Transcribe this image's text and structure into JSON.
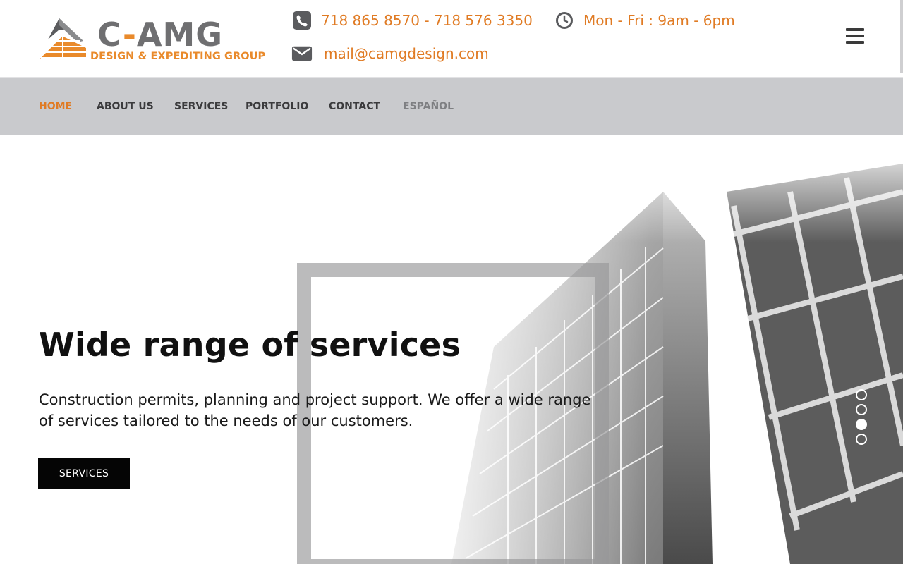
{
  "brand": {
    "logo_main_left": "C",
    "logo_main_dash": "-",
    "logo_main_right": "AMG",
    "logo_sub": "DESIGN & EXPEDITING GROUP",
    "brand_color": "#e98a2b",
    "logo_gray": "#6f6f71"
  },
  "contact": {
    "phone": "718 865 8570 - 718 576 3350",
    "phone_icon": "phone-icon",
    "hours": "Mon - Fri : 9am - 6pm",
    "hours_icon": "clock-icon",
    "email": "mail@camgdesign.com",
    "email_icon": "envelope-icon"
  },
  "menu_icon": "hamburger-menu-icon",
  "nav": {
    "items": [
      {
        "label": "HOME",
        "state": "active"
      },
      {
        "label": "ABOUT US",
        "state": "normal"
      },
      {
        "label": "SERVICES",
        "state": "normal"
      },
      {
        "label": "PORTFOLIO",
        "state": "normal"
      },
      {
        "label": "CONTACT",
        "state": "normal"
      },
      {
        "label": "ESPAÑOL",
        "state": "muted"
      }
    ],
    "active_color": "#e07b24",
    "background": "#c9cacd"
  },
  "hero": {
    "title": "Wide range of services",
    "description": "Construction permits, planning and project support. We offer a wide range of services tailored to the needs of our customers.",
    "button_label": "SERVICES",
    "slides_total": 4,
    "active_slide": 3
  }
}
